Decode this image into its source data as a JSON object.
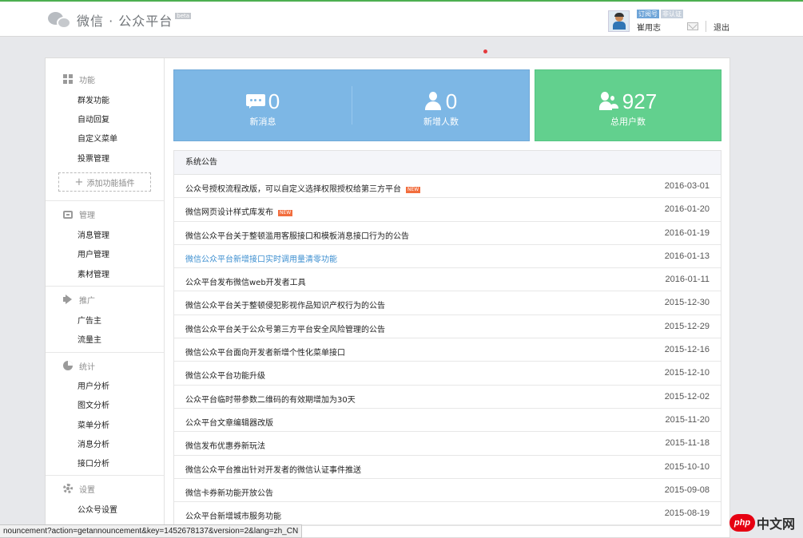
{
  "header": {
    "logo_text": "微信 · 公众平台",
    "beta": "beta",
    "account_type": "订阅号",
    "verify_status": "非认证",
    "user_name": "崔用志",
    "logout": "退出"
  },
  "sidebar": {
    "sections": [
      {
        "title": "功能",
        "icon": "grid-icon",
        "items": [
          "群发功能",
          "自动回复",
          "自定义菜单",
          "投票管理"
        ],
        "add_plugin": "添加功能插件"
      },
      {
        "title": "管理",
        "icon": "inbox-icon",
        "items": [
          "消息管理",
          "用户管理",
          "素材管理"
        ]
      },
      {
        "title": "推广",
        "icon": "megaphone-icon",
        "items": [
          "广告主",
          "流量主"
        ]
      },
      {
        "title": "统计",
        "icon": "pie-chart-icon",
        "items": [
          "用户分析",
          "图文分析",
          "菜单分析",
          "消息分析",
          "接口分析"
        ]
      },
      {
        "title": "设置",
        "icon": "gear-icon",
        "items": [
          "公众号设置"
        ]
      }
    ]
  },
  "stats": {
    "new_messages": {
      "value": "0",
      "label": "新消息"
    },
    "new_users": {
      "value": "0",
      "label": "新增人数"
    },
    "total_users": {
      "value": "927",
      "label": "总用户数"
    }
  },
  "notice": {
    "title": "系统公告",
    "new_tag": "NEW",
    "rows": [
      {
        "title": "公众号授权流程改版，可以自定义选择权限授权给第三方平台",
        "date": "2016-03-01",
        "is_new": true
      },
      {
        "title": "微信网页设计样式库发布",
        "date": "2016-01-20",
        "is_new": true
      },
      {
        "title": "微信公众平台关于整顿滥用客服接口和模板消息接口行为的公告",
        "date": "2016-01-19"
      },
      {
        "title": "微信公众平台新增接口实时调用量清零功能",
        "date": "2016-01-13",
        "visited": true
      },
      {
        "title": "公众平台发布微信web开发者工具",
        "date": "2016-01-11"
      },
      {
        "title": "微信公众平台关于整顿侵犯影视作品知识产权行为的公告",
        "date": "2015-12-30"
      },
      {
        "title": "微信公众平台关于公众号第三方平台安全风险管理的公告",
        "date": "2015-12-29"
      },
      {
        "title": "微信公众平台面向开发者新增个性化菜单接口",
        "date": "2015-12-16"
      },
      {
        "title": "微信公众平台功能升级",
        "date": "2015-12-10"
      },
      {
        "title": "公众平台临时带参数二维码的有效期增加为30天",
        "date": "2015-12-02"
      },
      {
        "title": "公众平台文章编辑器改版",
        "date": "2015-11-20"
      },
      {
        "title": "微信发布优惠券新玩法",
        "date": "2015-11-18"
      },
      {
        "title": "微信公众平台推出针对开发者的微信认证事件推送",
        "date": "2015-10-10"
      },
      {
        "title": "微信卡券新功能开放公告",
        "date": "2015-09-08"
      },
      {
        "title": "公众平台新增城市服务功能",
        "date": "2015-08-19"
      }
    ]
  },
  "status_bar": {
    "url": "nouncement?action=getannouncement&key=1452678137&version=2&lang=zh_CN"
  },
  "watermark": {
    "badge": "php",
    "text": "中文网"
  }
}
